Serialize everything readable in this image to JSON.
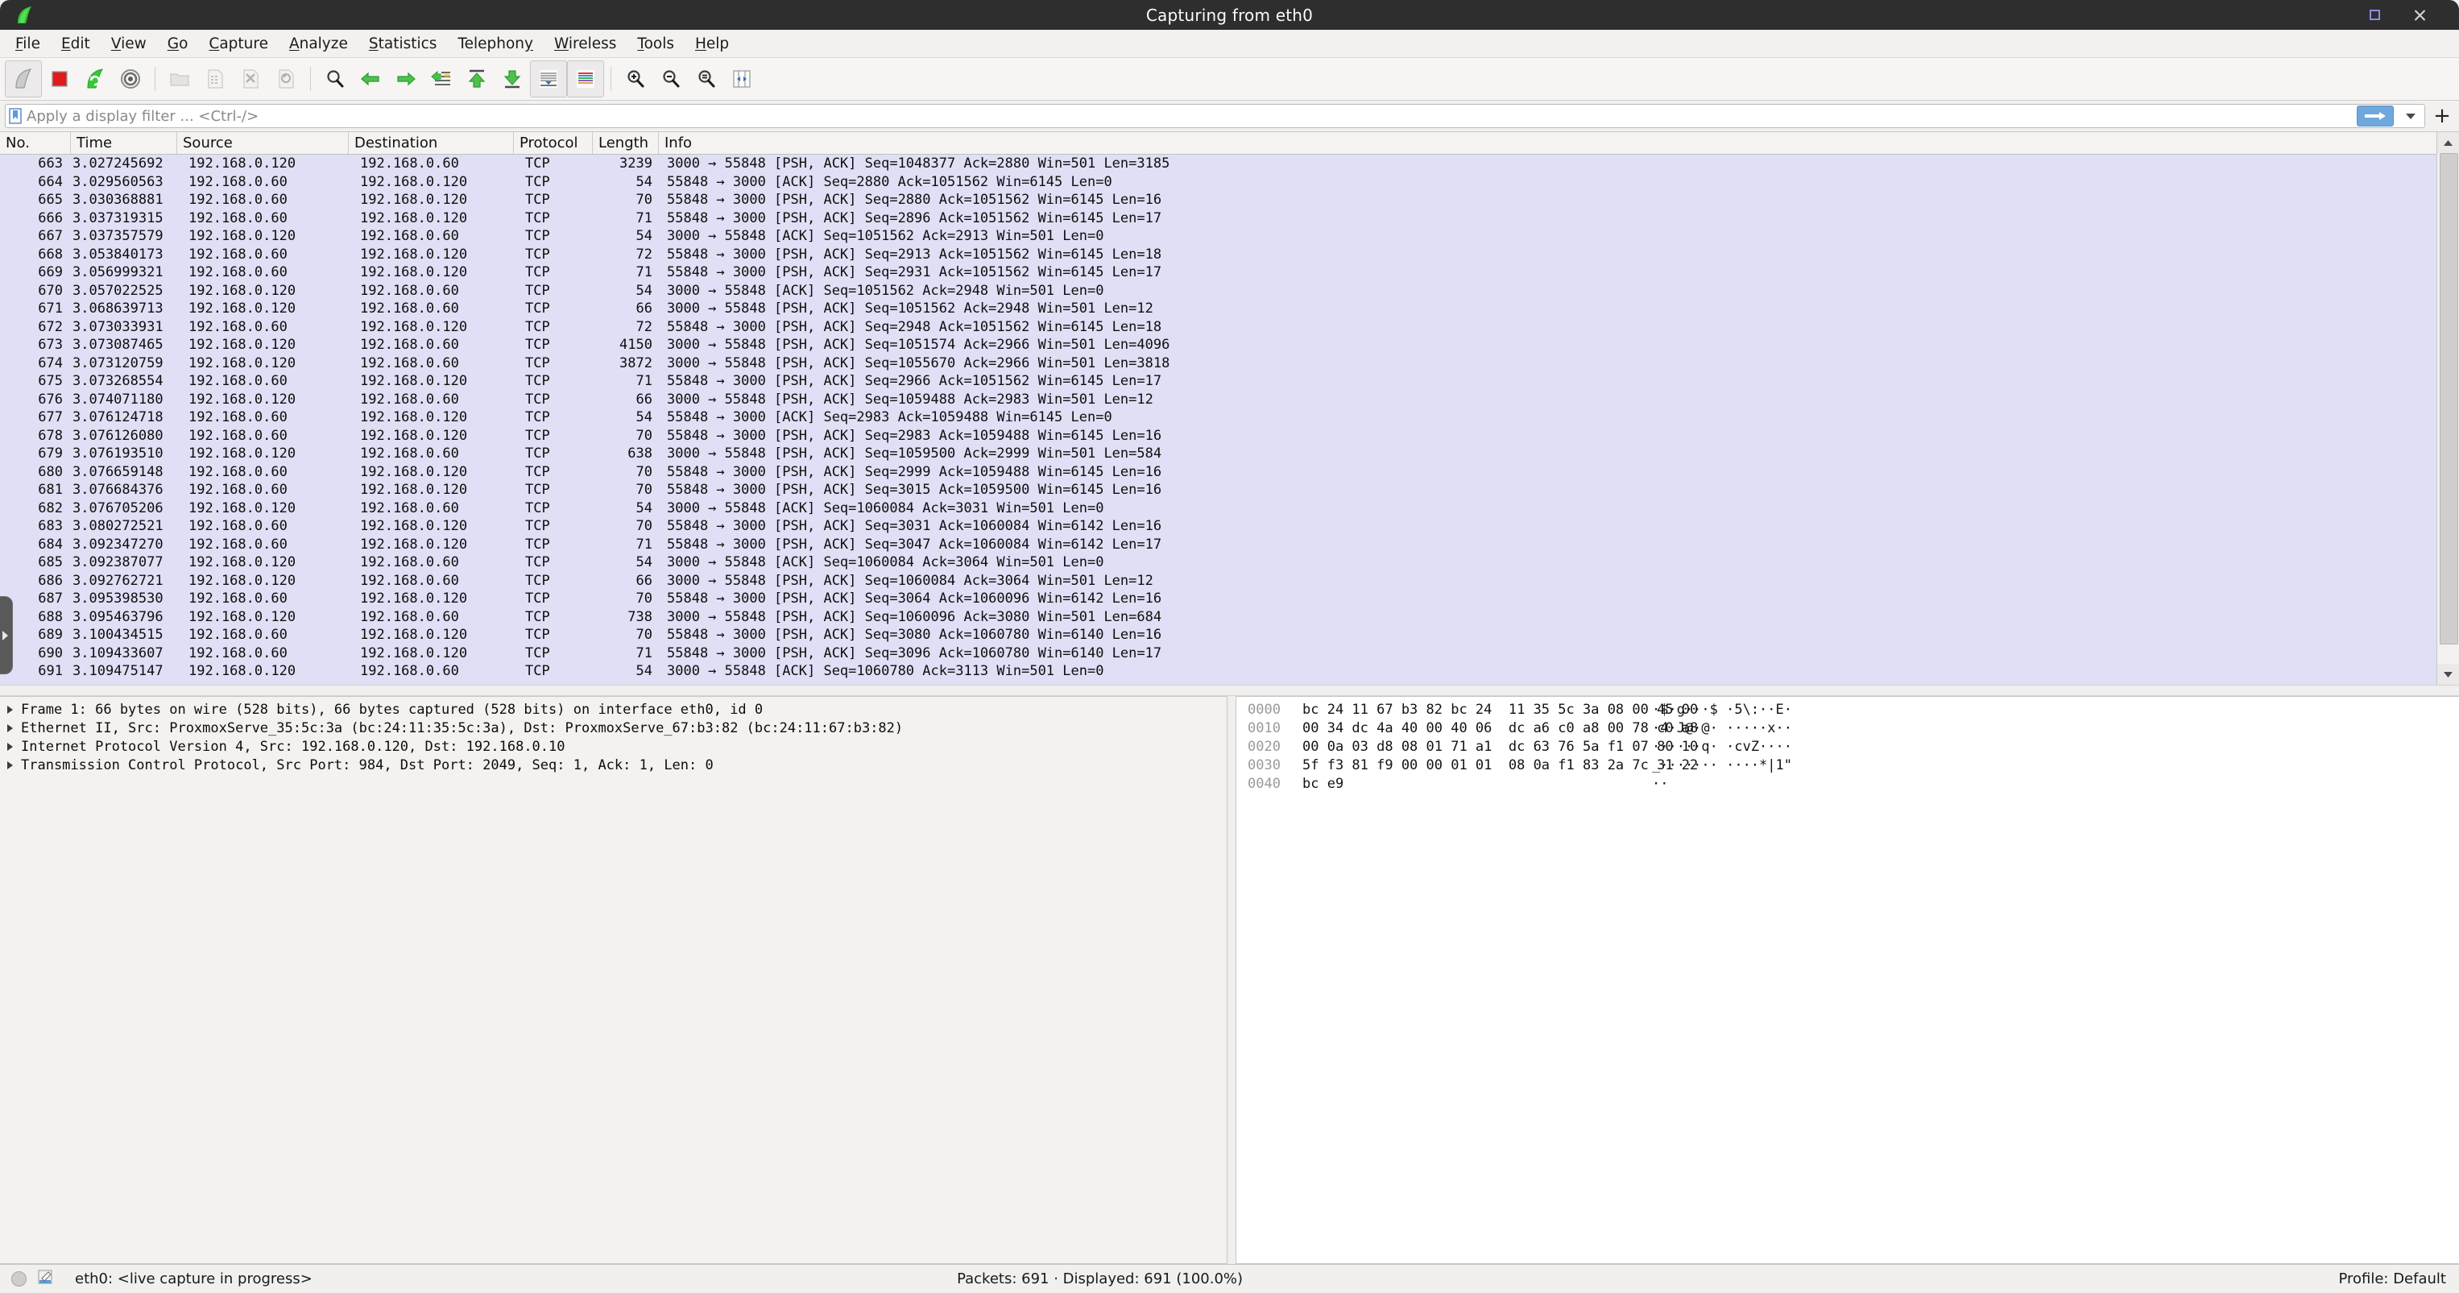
{
  "window": {
    "title": "Capturing from eth0",
    "logo_icon": "wireshark-fin-logo-icon",
    "controls": [
      {
        "name": "maximize-button",
        "icon": "maximize-square-icon",
        "label": "Maximize"
      },
      {
        "name": "close-button",
        "icon": "close-x-icon",
        "label": "Close"
      }
    ]
  },
  "menu": {
    "items": [
      {
        "label": "File",
        "mnemonic": "F"
      },
      {
        "label": "Edit",
        "mnemonic": "E"
      },
      {
        "label": "View",
        "mnemonic": "V"
      },
      {
        "label": "Go",
        "mnemonic": "G"
      },
      {
        "label": "Capture",
        "mnemonic": "C"
      },
      {
        "label": "Analyze",
        "mnemonic": "A"
      },
      {
        "label": "Statistics",
        "mnemonic": "S"
      },
      {
        "label": "Telephony",
        "mnemonic": "T"
      },
      {
        "label": "Wireless",
        "mnemonic": "W"
      },
      {
        "label": "Tools",
        "mnemonic": "T"
      },
      {
        "label": "Help",
        "mnemonic": "H"
      }
    ]
  },
  "toolbar": {
    "buttons": [
      {
        "name": "start-capture-button",
        "icon": "shark-fin-start-icon",
        "label": "Start capturing packets",
        "state": "active"
      },
      {
        "name": "stop-capture-button",
        "icon": "red-square-stop-icon",
        "label": "Stop capturing packets",
        "state": "enabled"
      },
      {
        "name": "restart-capture-button",
        "icon": "green-restart-fin-icon",
        "label": "Restart current capture",
        "state": "enabled"
      },
      {
        "name": "capture-options-button",
        "icon": "gear-options-icon",
        "label": "Capture options",
        "state": "enabled"
      },
      {
        "name": "open-file-button",
        "icon": "folder-open-icon",
        "label": "Open a capture file",
        "state": "disabled"
      },
      {
        "name": "save-file-button",
        "icon": "save-file-icon",
        "label": "Save this capture file",
        "state": "disabled"
      },
      {
        "name": "close-file-button",
        "icon": "close-file-x-icon",
        "label": "Close this capture file",
        "state": "disabled"
      },
      {
        "name": "reload-file-button",
        "icon": "reload-file-icon",
        "label": "Reload this file",
        "state": "disabled"
      },
      {
        "name": "find-packet-button",
        "icon": "magnifier-search-icon",
        "label": "Find a packet",
        "state": "enabled"
      },
      {
        "name": "go-back-button",
        "icon": "green-arrow-left-icon",
        "label": "Go back in packet history",
        "state": "enabled"
      },
      {
        "name": "go-forward-button",
        "icon": "green-arrow-right-icon",
        "label": "Go forward in packet history",
        "state": "enabled"
      },
      {
        "name": "go-to-packet-button",
        "icon": "goto-packet-icon",
        "label": "Go to the packet with number",
        "state": "enabled"
      },
      {
        "name": "go-to-first-button",
        "icon": "green-arrow-up-first-icon",
        "label": "Go to the first packet",
        "state": "enabled"
      },
      {
        "name": "go-to-last-button",
        "icon": "green-arrow-down-last-icon",
        "label": "Go to the last packet",
        "state": "enabled"
      },
      {
        "name": "auto-scroll-button",
        "icon": "auto-scroll-live-icon",
        "label": "Auto scroll in live capture",
        "state": "toggled"
      },
      {
        "name": "colorize-button",
        "icon": "colorize-packet-list-icon",
        "label": "Colorize packet list",
        "state": "toggled"
      },
      {
        "name": "zoom-in-button",
        "icon": "zoom-in-magnifier-icon",
        "label": "Zoom in",
        "state": "enabled"
      },
      {
        "name": "zoom-out-button",
        "icon": "zoom-out-magnifier-icon",
        "label": "Zoom out",
        "state": "enabled"
      },
      {
        "name": "zoom-reset-button",
        "icon": "zoom-reset-magnifier-icon",
        "label": "Reset zoom level",
        "state": "enabled"
      },
      {
        "name": "resize-columns-button",
        "icon": "resize-columns-icon",
        "label": "Resize columns to fit contents",
        "state": "enabled"
      }
    ]
  },
  "filter": {
    "bookmark_icon": "filter-bookmark-icon",
    "value": "",
    "placeholder": "Apply a display filter ... <Ctrl-/>",
    "apply_icon": "apply-filter-arrow-icon",
    "dropdown_icon": "chevron-down-icon",
    "add_icon": "add-filter-plus-icon"
  },
  "packet_list": {
    "columns": [
      "No.",
      "Time",
      "Source",
      "Destination",
      "Protocol",
      "Length",
      "Info"
    ],
    "scroll": {
      "up_icon": "scroll-up-arrow-icon",
      "down_icon": "scroll-down-arrow-icon"
    },
    "collapse_handle_icon": "pane-collapse-arrow-icon",
    "rows": [
      {
        "no": "663",
        "time": "3.027245692",
        "src": "192.168.0.120",
        "dst": "192.168.0.60",
        "proto": "TCP",
        "len": "3239",
        "info": "3000 → 55848 [PSH, ACK] Seq=1048377 Ack=2880 Win=501 Len=3185"
      },
      {
        "no": "664",
        "time": "3.029560563",
        "src": "192.168.0.60",
        "dst": "192.168.0.120",
        "proto": "TCP",
        "len": "54",
        "info": "55848 → 3000 [ACK] Seq=2880 Ack=1051562 Win=6145 Len=0"
      },
      {
        "no": "665",
        "time": "3.030368881",
        "src": "192.168.0.60",
        "dst": "192.168.0.120",
        "proto": "TCP",
        "len": "70",
        "info": "55848 → 3000 [PSH, ACK] Seq=2880 Ack=1051562 Win=6145 Len=16"
      },
      {
        "no": "666",
        "time": "3.037319315",
        "src": "192.168.0.60",
        "dst": "192.168.0.120",
        "proto": "TCP",
        "len": "71",
        "info": "55848 → 3000 [PSH, ACK] Seq=2896 Ack=1051562 Win=6145 Len=17"
      },
      {
        "no": "667",
        "time": "3.037357579",
        "src": "192.168.0.120",
        "dst": "192.168.0.60",
        "proto": "TCP",
        "len": "54",
        "info": "3000 → 55848 [ACK] Seq=1051562 Ack=2913 Win=501 Len=0"
      },
      {
        "no": "668",
        "time": "3.053840173",
        "src": "192.168.0.60",
        "dst": "192.168.0.120",
        "proto": "TCP",
        "len": "72",
        "info": "55848 → 3000 [PSH, ACK] Seq=2913 Ack=1051562 Win=6145 Len=18"
      },
      {
        "no": "669",
        "time": "3.056999321",
        "src": "192.168.0.60",
        "dst": "192.168.0.120",
        "proto": "TCP",
        "len": "71",
        "info": "55848 → 3000 [PSH, ACK] Seq=2931 Ack=1051562 Win=6145 Len=17"
      },
      {
        "no": "670",
        "time": "3.057022525",
        "src": "192.168.0.120",
        "dst": "192.168.0.60",
        "proto": "TCP",
        "len": "54",
        "info": "3000 → 55848 [ACK] Seq=1051562 Ack=2948 Win=501 Len=0"
      },
      {
        "no": "671",
        "time": "3.068639713",
        "src": "192.168.0.120",
        "dst": "192.168.0.60",
        "proto": "TCP",
        "len": "66",
        "info": "3000 → 55848 [PSH, ACK] Seq=1051562 Ack=2948 Win=501 Len=12"
      },
      {
        "no": "672",
        "time": "3.073033931",
        "src": "192.168.0.60",
        "dst": "192.168.0.120",
        "proto": "TCP",
        "len": "72",
        "info": "55848 → 3000 [PSH, ACK] Seq=2948 Ack=1051562 Win=6145 Len=18"
      },
      {
        "no": "673",
        "time": "3.073087465",
        "src": "192.168.0.120",
        "dst": "192.168.0.60",
        "proto": "TCP",
        "len": "4150",
        "info": "3000 → 55848 [PSH, ACK] Seq=1051574 Ack=2966 Win=501 Len=4096"
      },
      {
        "no": "674",
        "time": "3.073120759",
        "src": "192.168.0.120",
        "dst": "192.168.0.60",
        "proto": "TCP",
        "len": "3872",
        "info": "3000 → 55848 [PSH, ACK] Seq=1055670 Ack=2966 Win=501 Len=3818"
      },
      {
        "no": "675",
        "time": "3.073268554",
        "src": "192.168.0.60",
        "dst": "192.168.0.120",
        "proto": "TCP",
        "len": "71",
        "info": "55848 → 3000 [PSH, ACK] Seq=2966 Ack=1051562 Win=6145 Len=17"
      },
      {
        "no": "676",
        "time": "3.074071180",
        "src": "192.168.0.120",
        "dst": "192.168.0.60",
        "proto": "TCP",
        "len": "66",
        "info": "3000 → 55848 [PSH, ACK] Seq=1059488 Ack=2983 Win=501 Len=12"
      },
      {
        "no": "677",
        "time": "3.076124718",
        "src": "192.168.0.60",
        "dst": "192.168.0.120",
        "proto": "TCP",
        "len": "54",
        "info": "55848 → 3000 [ACK] Seq=2983 Ack=1059488 Win=6145 Len=0"
      },
      {
        "no": "678",
        "time": "3.076126080",
        "src": "192.168.0.60",
        "dst": "192.168.0.120",
        "proto": "TCP",
        "len": "70",
        "info": "55848 → 3000 [PSH, ACK] Seq=2983 Ack=1059488 Win=6145 Len=16"
      },
      {
        "no": "679",
        "time": "3.076193510",
        "src": "192.168.0.120",
        "dst": "192.168.0.60",
        "proto": "TCP",
        "len": "638",
        "info": "3000 → 55848 [PSH, ACK] Seq=1059500 Ack=2999 Win=501 Len=584"
      },
      {
        "no": "680",
        "time": "3.076659148",
        "src": "192.168.0.60",
        "dst": "192.168.0.120",
        "proto": "TCP",
        "len": "70",
        "info": "55848 → 3000 [PSH, ACK] Seq=2999 Ack=1059488 Win=6145 Len=16"
      },
      {
        "no": "681",
        "time": "3.076684376",
        "src": "192.168.0.60",
        "dst": "192.168.0.120",
        "proto": "TCP",
        "len": "70",
        "info": "55848 → 3000 [PSH, ACK] Seq=3015 Ack=1059500 Win=6145 Len=16"
      },
      {
        "no": "682",
        "time": "3.076705206",
        "src": "192.168.0.120",
        "dst": "192.168.0.60",
        "proto": "TCP",
        "len": "54",
        "info": "3000 → 55848 [ACK] Seq=1060084 Ack=3031 Win=501 Len=0"
      },
      {
        "no": "683",
        "time": "3.080272521",
        "src": "192.168.0.60",
        "dst": "192.168.0.120",
        "proto": "TCP",
        "len": "70",
        "info": "55848 → 3000 [PSH, ACK] Seq=3031 Ack=1060084 Win=6142 Len=16"
      },
      {
        "no": "684",
        "time": "3.092347270",
        "src": "192.168.0.60",
        "dst": "192.168.0.120",
        "proto": "TCP",
        "len": "71",
        "info": "55848 → 3000 [PSH, ACK] Seq=3047 Ack=1060084 Win=6142 Len=17"
      },
      {
        "no": "685",
        "time": "3.092387077",
        "src": "192.168.0.120",
        "dst": "192.168.0.60",
        "proto": "TCP",
        "len": "54",
        "info": "3000 → 55848 [ACK] Seq=1060084 Ack=3064 Win=501 Len=0"
      },
      {
        "no": "686",
        "time": "3.092762721",
        "src": "192.168.0.120",
        "dst": "192.168.0.60",
        "proto": "TCP",
        "len": "66",
        "info": "3000 → 55848 [PSH, ACK] Seq=1060084 Ack=3064 Win=501 Len=12"
      },
      {
        "no": "687",
        "time": "3.095398530",
        "src": "192.168.0.60",
        "dst": "192.168.0.120",
        "proto": "TCP",
        "len": "70",
        "info": "55848 → 3000 [PSH, ACK] Seq=3064 Ack=1060096 Win=6142 Len=16"
      },
      {
        "no": "688",
        "time": "3.095463796",
        "src": "192.168.0.120",
        "dst": "192.168.0.60",
        "proto": "TCP",
        "len": "738",
        "info": "3000 → 55848 [PSH, ACK] Seq=1060096 Ack=3080 Win=501 Len=684"
      },
      {
        "no": "689",
        "time": "3.100434515",
        "src": "192.168.0.60",
        "dst": "192.168.0.120",
        "proto": "TCP",
        "len": "70",
        "info": "55848 → 3000 [PSH, ACK] Seq=3080 Ack=1060780 Win=6140 Len=16"
      },
      {
        "no": "690",
        "time": "3.109433607",
        "src": "192.168.0.60",
        "dst": "192.168.0.120",
        "proto": "TCP",
        "len": "71",
        "info": "55848 → 3000 [PSH, ACK] Seq=3096 Ack=1060780 Win=6140 Len=17"
      },
      {
        "no": "691",
        "time": "3.109475147",
        "src": "192.168.0.120",
        "dst": "192.168.0.60",
        "proto": "TCP",
        "len": "54",
        "info": "3000 → 55848 [ACK] Seq=1060780 Ack=3113 Win=501 Len=0"
      }
    ]
  },
  "packet_details": {
    "rows": [
      {
        "text": "Frame 1: 66 bytes on wire (528 bits), 66 bytes captured (528 bits) on interface eth0, id 0",
        "expanded": false
      },
      {
        "text": "Ethernet II, Src: ProxmoxServe_35:5c:3a (bc:24:11:35:5c:3a), Dst: ProxmoxServe_67:b3:82 (bc:24:11:67:b3:82)",
        "expanded": false
      },
      {
        "text": "Internet Protocol Version 4, Src: 192.168.0.120, Dst: 192.168.0.10",
        "expanded": false
      },
      {
        "text": "Transmission Control Protocol, Src Port: 984, Dst Port: 2049, Seq: 1, Ack: 1, Len: 0",
        "expanded": false
      }
    ]
  },
  "packet_bytes": {
    "rows": [
      {
        "offset": "0000",
        "hex": "bc 24 11 67 b3 82 bc 24  11 35 5c 3a 08 00 45 00",
        "ascii": "·$·g···$ ·5\\:··E·"
      },
      {
        "offset": "0010",
        "hex": "00 34 dc 4a 40 00 40 06  dc a6 c0 a8 00 78 c0 a8",
        "ascii": "·4·J@·@· ·····x··"
      },
      {
        "offset": "0020",
        "hex": "00 0a 03 d8 08 01 71 a1  dc 63 76 5a f1 07 80 10",
        "ascii": "······q· ·cvZ····"
      },
      {
        "offset": "0030",
        "hex": "5f f3 81 f9 00 00 01 01  08 0a f1 83 2a 7c 31 22",
        "ascii": "_······· ····*|1\""
      },
      {
        "offset": "0040",
        "hex": "bc e9",
        "ascii": "··"
      }
    ]
  },
  "statusbar": {
    "expert_icon": "expert-info-circle-icon",
    "capture-file-properties_icon": "capture-comment-icon",
    "interface_text": "eth0: <live capture in progress>",
    "packets_text": "Packets: 691 · Displayed: 691 (100.0%)",
    "profile_text": "Profile: Default"
  },
  "colors": {
    "titlebar_bg": "#2e2e2e",
    "packet_row_bg": "#dfdff5",
    "accent_blue": "#6fa8dc",
    "maximize_accent": "#8e8ce0"
  }
}
